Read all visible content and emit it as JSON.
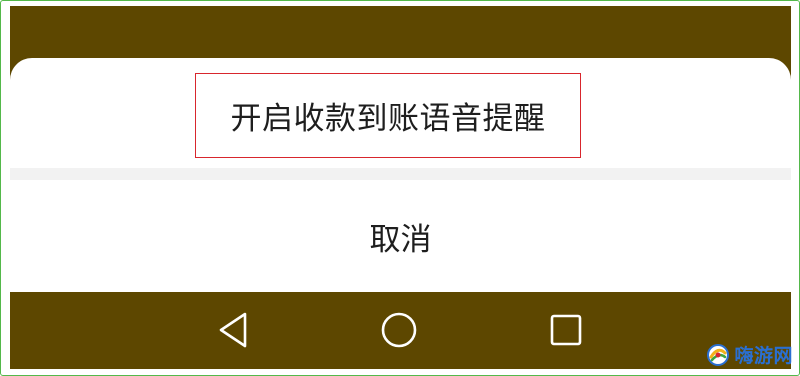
{
  "sheet": {
    "option_label": "开启收款到账语音提醒",
    "cancel_label": "取消"
  },
  "navigation": {
    "buttons": [
      {
        "name": "back",
        "icon": "triangle-back-icon"
      },
      {
        "name": "home",
        "icon": "circle-home-icon"
      },
      {
        "name": "recent",
        "icon": "square-recents-icon"
      }
    ]
  },
  "watermark": {
    "text": "嗨游网",
    "logo": "haiyou-logo"
  },
  "colors": {
    "scrim": "#5d4700",
    "frame_border": "#53b84a",
    "highlight_border": "#d8262d",
    "watermark_text": "#2a6fd1"
  }
}
